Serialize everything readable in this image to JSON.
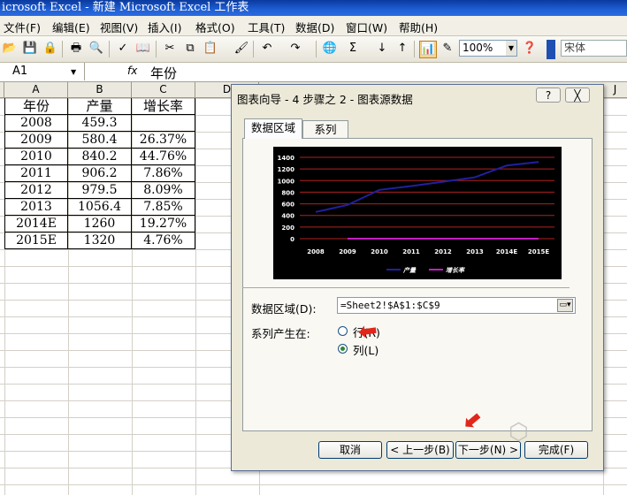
{
  "window": {
    "title": "icrosoft Excel - 新建 Microsoft Excel 工作表"
  },
  "menu": [
    "文件(F)",
    "编辑(E)",
    "视图(V)",
    "插入(I)",
    "格式(O)",
    "工具(T)",
    "数据(D)",
    "窗口(W)",
    "帮助(H)"
  ],
  "toolbar": {
    "zoom": "100%",
    "font": "宋体"
  },
  "formula_bar": {
    "name_box": "A1",
    "fx": "fx",
    "content": "年份"
  },
  "columns": [
    "A",
    "B",
    "C",
    "D",
    "J"
  ],
  "table": {
    "headers": [
      "年份",
      "产量",
      "增长率"
    ],
    "rows": [
      [
        "2008",
        "459.3",
        ""
      ],
      [
        "2009",
        "580.4",
        "26.37%"
      ],
      [
        "2010",
        "840.2",
        "44.76%"
      ],
      [
        "2011",
        "906.2",
        "7.86%"
      ],
      [
        "2012",
        "979.5",
        "8.09%"
      ],
      [
        "2013",
        "1056.4",
        "7.85%"
      ],
      [
        "2014E",
        "1260",
        "19.27%"
      ],
      [
        "2015E",
        "1320",
        "4.76%"
      ]
    ]
  },
  "dialog": {
    "title": "图表向导 - 4 步骤之 2 - 图表源数据",
    "help": "?",
    "close": "╳",
    "tabs": [
      "数据区域",
      "系列"
    ],
    "data_range_label": "数据区域(D):",
    "data_range_value": "=Sheet2!$A$1:$C$9",
    "series_in_label": "系列产生在:",
    "options": {
      "row": "行(R)",
      "col": "列(L)"
    },
    "selected_option": "col",
    "buttons": {
      "cancel": "取消",
      "back": "< 上一步(B)",
      "next": "下一步(N) >",
      "finish": "完成(F)"
    }
  },
  "chart_data": {
    "type": "line",
    "x": [
      "2008",
      "2009",
      "2010",
      "2011",
      "2012",
      "2013",
      "2014E",
      "2015E"
    ],
    "ylim": [
      0,
      1400
    ],
    "yticks": [
      0,
      200,
      400,
      600,
      800,
      1000,
      1200,
      1400
    ],
    "series": [
      {
        "name": "产量",
        "color": "#2020a0",
        "values": [
          459.3,
          580.4,
          840.2,
          906.2,
          979.5,
          1056.4,
          1260,
          1320
        ]
      },
      {
        "name": "增长率",
        "color": "#c020c0",
        "values": [
          null,
          0.2637,
          0.4476,
          0.0786,
          0.0809,
          0.0785,
          0.1927,
          0.0476
        ]
      }
    ],
    "legend": "bottom",
    "grid": true,
    "gridline_color": "#b02020",
    "background": "#000000"
  },
  "colors": {
    "titlebar": "#1f5fd4",
    "annotation_arrow": "#e1261c"
  }
}
